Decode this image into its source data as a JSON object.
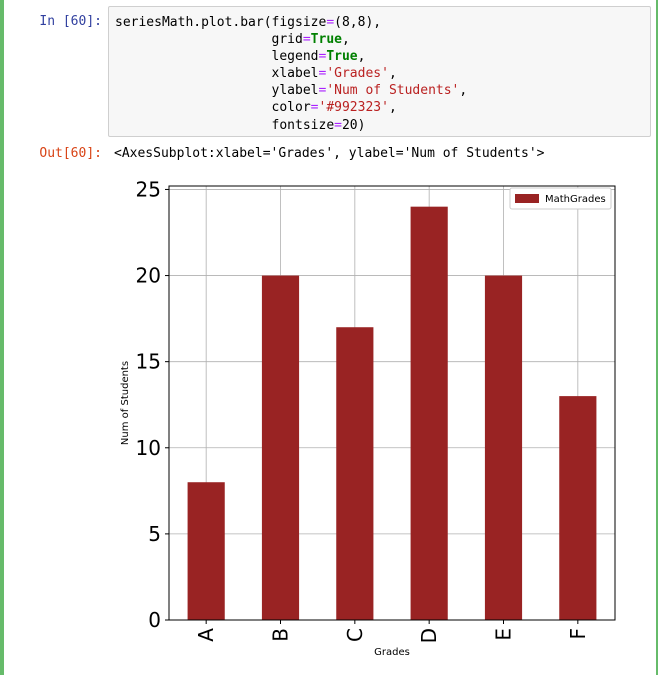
{
  "cell": {
    "in_prompt": "In [60]:",
    "out_prompt": "Out[60]:",
    "code_lines": [
      [
        "seriesMath.plot.bar(figsize=(8,8),"
      ],
      [
        "                    grid=",
        "True",
        ","
      ],
      [
        "                    legend=",
        "True",
        ","
      ],
      [
        "                    xlabel=",
        "'Grades'",
        ","
      ],
      [
        "                    ylabel=",
        "'Num of Students'",
        ","
      ],
      [
        "                    color=",
        "'#992323'",
        ","
      ],
      [
        "                    fontsize=20)"
      ]
    ],
    "output_text": "<AxesSubplot:xlabel='Grades', ylabel='Num of Students'>"
  },
  "chart_data": {
    "type": "bar",
    "categories": [
      "A",
      "B",
      "C",
      "D",
      "E",
      "F"
    ],
    "series": [
      {
        "name": "MathGrades",
        "values": [
          8,
          20,
          17,
          24,
          20,
          13
        ]
      }
    ],
    "xlabel": "Grades",
    "ylabel": "Num of Students",
    "ylim": [
      0,
      25.2
    ],
    "yticks": [
      0,
      5,
      10,
      15,
      20,
      25
    ],
    "grid": true,
    "legend_position": "top-right",
    "bar_color": "#992323",
    "tick_label_rotation_x": "vertical"
  }
}
